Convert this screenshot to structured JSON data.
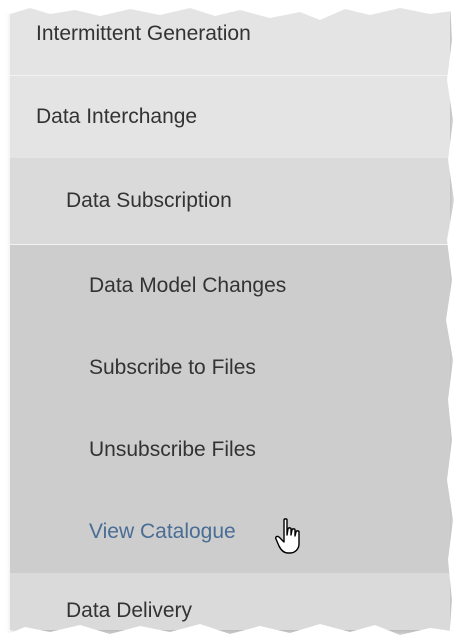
{
  "menu": {
    "items": [
      {
        "label": "Intermittent Generation"
      },
      {
        "label": "Data Interchange"
      },
      {
        "label": "Data Subscription"
      },
      {
        "label": "Data Model Changes"
      },
      {
        "label": "Subscribe to Files"
      },
      {
        "label": "Unsubscribe Files"
      },
      {
        "label": "View Catalogue",
        "state": "hovered"
      },
      {
        "label": "Data Delivery"
      }
    ],
    "colors": {
      "level0_bg": "#e4e4e4",
      "level1_bg": "#dadada",
      "level2_bg": "#cdcdcd",
      "text": "#333333",
      "active_text": "#4a6d95"
    }
  },
  "cursor": {
    "icon": "hand-pointer-icon"
  }
}
